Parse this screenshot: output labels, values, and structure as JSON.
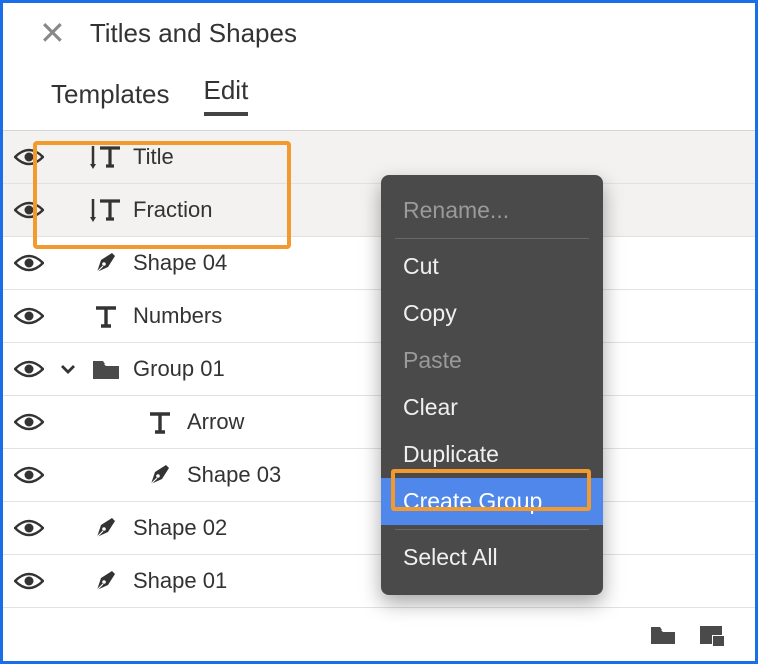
{
  "header": {
    "title": "Titles and Shapes"
  },
  "tabs": {
    "templates": "Templates",
    "edit": "Edit"
  },
  "layers": [
    {
      "name": "Title",
      "icon": "roll-text",
      "selected": true
    },
    {
      "name": "Fraction",
      "icon": "roll-text",
      "selected": true
    },
    {
      "name": "Shape 04",
      "icon": "pen"
    },
    {
      "name": "Numbers",
      "icon": "text"
    },
    {
      "name": "Group 01",
      "icon": "folder",
      "expanded": true
    },
    {
      "name": "Arrow",
      "icon": "text",
      "nested": true
    },
    {
      "name": "Shape 03",
      "icon": "pen",
      "nested": true
    },
    {
      "name": "Shape 02",
      "icon": "pen"
    },
    {
      "name": "Shape 01",
      "icon": "pen"
    }
  ],
  "context_menu": {
    "rename": "Rename...",
    "cut": "Cut",
    "copy": "Copy",
    "paste": "Paste",
    "clear": "Clear",
    "duplicate": "Duplicate",
    "create_group": "Create Group",
    "select_all": "Select All"
  }
}
